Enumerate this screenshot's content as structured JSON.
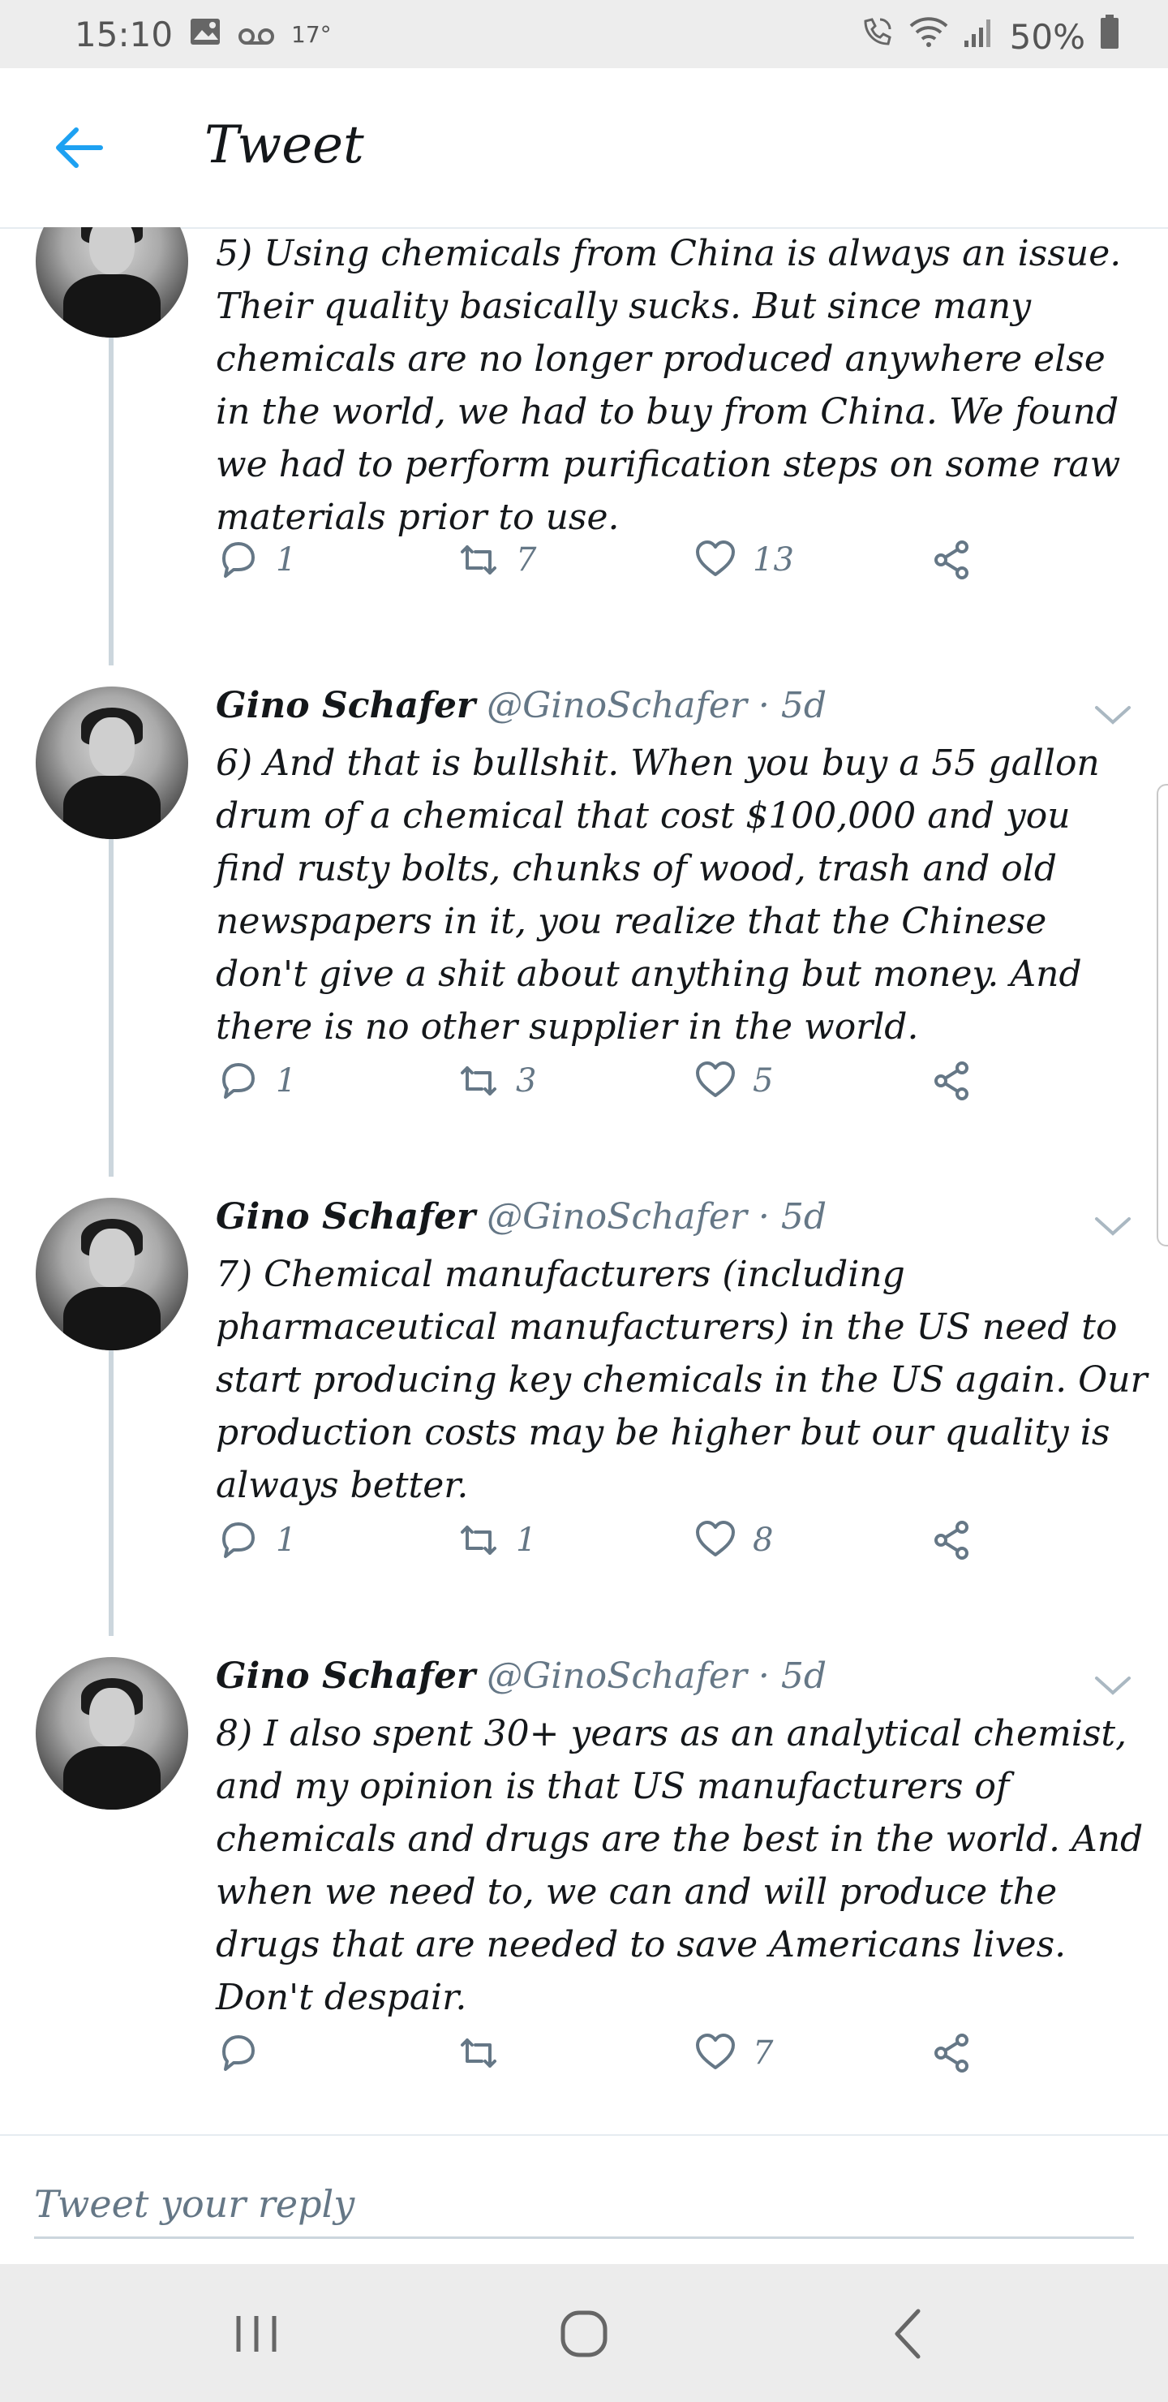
{
  "status_bar": {
    "time": "15:10",
    "temp": "17°",
    "battery": "50%",
    "icons": [
      "image-icon",
      "voicemail-icon",
      "call-wifi-icon",
      "wifi-icon",
      "signal-icon",
      "battery-icon"
    ]
  },
  "header": {
    "back_icon": "arrow-left-icon",
    "title": "Tweet"
  },
  "tweets": [
    {
      "name": "",
      "handle": "",
      "time": "",
      "text": "5) Using chemicals from China is always an issue. Their quality basically sucks. But since many chemicals are no longer produced anywhere else in the world, we had to buy from China. We found we had to perform purification steps on some raw materials prior to use.",
      "replies": "1",
      "retweets": "7",
      "likes": "13"
    },
    {
      "name": "Gino Schafer",
      "handle": "@GinoSchafer",
      "time": "· 5d",
      "text": "6) And that is bullshit. When you buy a 55 gallon drum of a chemical that cost $100,000 and you find rusty bolts, chunks of wood, trash and old newspapers in it, you realize that the Chinese don't give a shit about anything but money. And there is no other supplier in the world.",
      "replies": "1",
      "retweets": "3",
      "likes": "5"
    },
    {
      "name": "Gino Schafer",
      "handle": "@GinoSchafer",
      "time": "· 5d",
      "text": "7) Chemical manufacturers (including pharmaceutical manufacturers) in the US need to start producing key chemicals in the US again. Our production costs may be higher but our quality is always better.",
      "replies": "1",
      "retweets": "1",
      "likes": "8"
    },
    {
      "name": "Gino Schafer",
      "handle": "@GinoSchafer",
      "time": "· 5d",
      "text": "8) I also spent 30+ years as an analytical chemist, and my opinion is that US manufacturers of chemicals and drugs are the best in the world. And when we need to, we can and will produce the drugs that are needed to save Americans lives. Don't despair.",
      "replies": "",
      "retweets": "",
      "likes": "7"
    }
  ],
  "reply": {
    "placeholder": "Tweet your reply"
  },
  "nav": {
    "icons": [
      "recent-apps-icon",
      "home-icon",
      "back-icon"
    ]
  },
  "colors": {
    "accent": "#1da1f2",
    "muted": "#657786",
    "text": "#14171a",
    "thread_line": "#ccd6dd"
  }
}
